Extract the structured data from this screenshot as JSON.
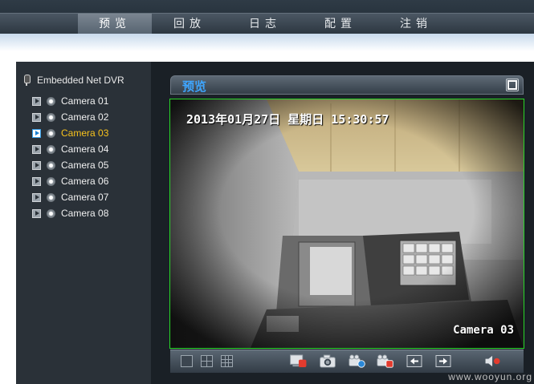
{
  "nav": {
    "items": [
      {
        "label": "预览",
        "active": true
      },
      {
        "label": "回放",
        "active": false
      },
      {
        "label": "日志",
        "active": false
      },
      {
        "label": "配置",
        "active": false
      },
      {
        "label": "注销",
        "active": false
      }
    ]
  },
  "sidebar": {
    "root_label": "Embedded Net DVR",
    "root_icon": "microphone-icon",
    "cameras": [
      {
        "label": "Camera 01",
        "selected": false
      },
      {
        "label": "Camera 02",
        "selected": false
      },
      {
        "label": "Camera 03",
        "selected": true
      },
      {
        "label": "Camera 04",
        "selected": false
      },
      {
        "label": "Camera 05",
        "selected": false
      },
      {
        "label": "Camera 06",
        "selected": false
      },
      {
        "label": "Camera 07",
        "selected": false
      },
      {
        "label": "Camera 08",
        "selected": false
      }
    ],
    "selected_color": "#f7c21d"
  },
  "preview": {
    "title": "预览",
    "fullscreen_icon": "fullscreen-icon",
    "osd_datetime": "2013年01月27日 星期日 15:30:57",
    "osd_camera": "Camera 03",
    "border_color": "#28d828",
    "title_color": "#3ea6ff"
  },
  "toolbar": {
    "icons": [
      "single-view-icon",
      "four-view-icon",
      "nine-view-icon",
      "stop-preview-icon",
      "snapshot-icon",
      "record-icon",
      "stop-record-icon",
      "previous-icon",
      "next-icon",
      "volume-mute-icon"
    ]
  },
  "watermark": "www.wooyun.org"
}
